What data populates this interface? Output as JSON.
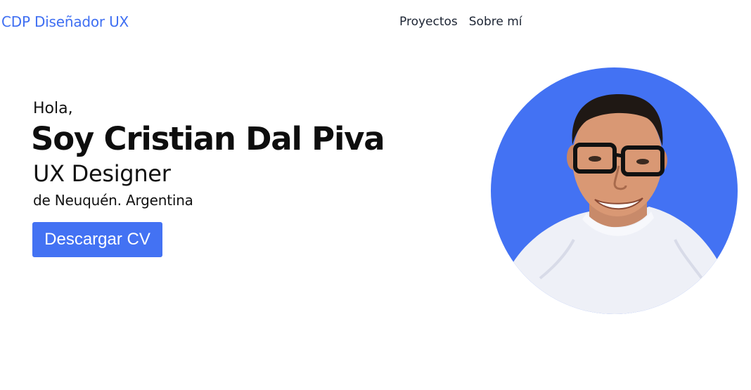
{
  "header": {
    "brand": "CDP Diseñador UX",
    "nav": [
      "Proyectos",
      "Sobre mí"
    ]
  },
  "hero": {
    "greeting": "Hola,",
    "name": "Soy Cristian Dal Piva",
    "role": "UX Designer",
    "location": "de Neuquén. Argentina",
    "cta": "Descargar CV"
  },
  "colors": {
    "accent": "#4372f3",
    "brand_text": "#3f6ff2",
    "nav_text": "#1c2433"
  },
  "icons": {
    "portrait": "profile-photo"
  }
}
